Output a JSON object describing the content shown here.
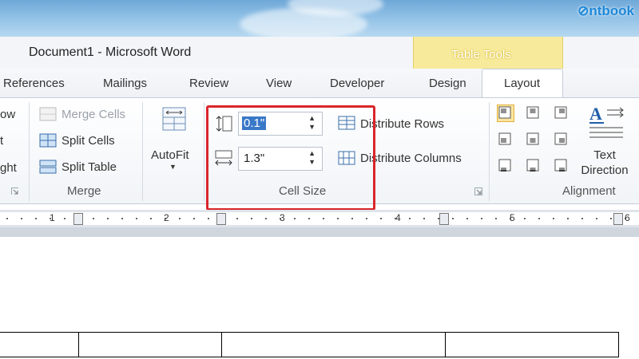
{
  "brand": {
    "logo_text": "ntbook"
  },
  "title": {
    "document": "Document1  -  Microsoft Word",
    "contextual_group": "Table Tools"
  },
  "tabs": [
    {
      "label": "References"
    },
    {
      "label": "Mailings"
    },
    {
      "label": "Review"
    },
    {
      "label": "View"
    },
    {
      "label": "Developer"
    },
    {
      "label": "Design"
    },
    {
      "label": "Layout",
      "active": true
    }
  ],
  "ribbon": {
    "rows_cols_partial": [
      "ow",
      "t",
      "ght"
    ],
    "merge": {
      "merge_cells": "Merge Cells",
      "split_cells": "Split Cells",
      "split_table": "Split Table",
      "group_label": "Merge"
    },
    "autofit": {
      "label": "AutoFit"
    },
    "cell_size": {
      "height_value": "0.1\"",
      "width_value": "1.3\"",
      "distribute_rows": "Distribute Rows",
      "distribute_columns": "Distribute Columns",
      "group_label": "Cell Size"
    },
    "alignment": {
      "text_direction": "Text Direction",
      "group_label": "Alignment"
    }
  },
  "ruler": {
    "numbers": [
      "1",
      "2",
      "3",
      "4",
      "5",
      "6"
    ]
  },
  "colors": {
    "highlight": "#d9262b",
    "table_tools": "#f7ea9a",
    "selection": "#3a78c8"
  }
}
